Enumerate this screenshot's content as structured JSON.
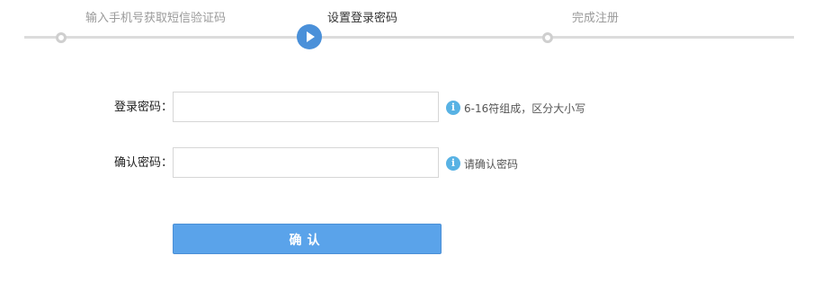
{
  "stepper": {
    "steps": [
      {
        "label": "输入手机号获取短信验证码",
        "state": "done"
      },
      {
        "label": "设置登录密码",
        "state": "current"
      },
      {
        "label": "完成注册",
        "state": "todo"
      }
    ]
  },
  "form": {
    "password": {
      "label": "登录密码：",
      "value": "",
      "hint": "6-16符组成，区分大小写"
    },
    "confirm": {
      "label": "确认密码：",
      "value": "",
      "hint": "请确认密码"
    },
    "submit_label": "确认"
  },
  "colors": {
    "accent": "#4a90d9",
    "button": "#5aa3ea",
    "info_icon": "#58b2e4",
    "track": "#dcdcdc"
  },
  "icons": {
    "info": "info-icon",
    "current_step": "play-icon"
  }
}
